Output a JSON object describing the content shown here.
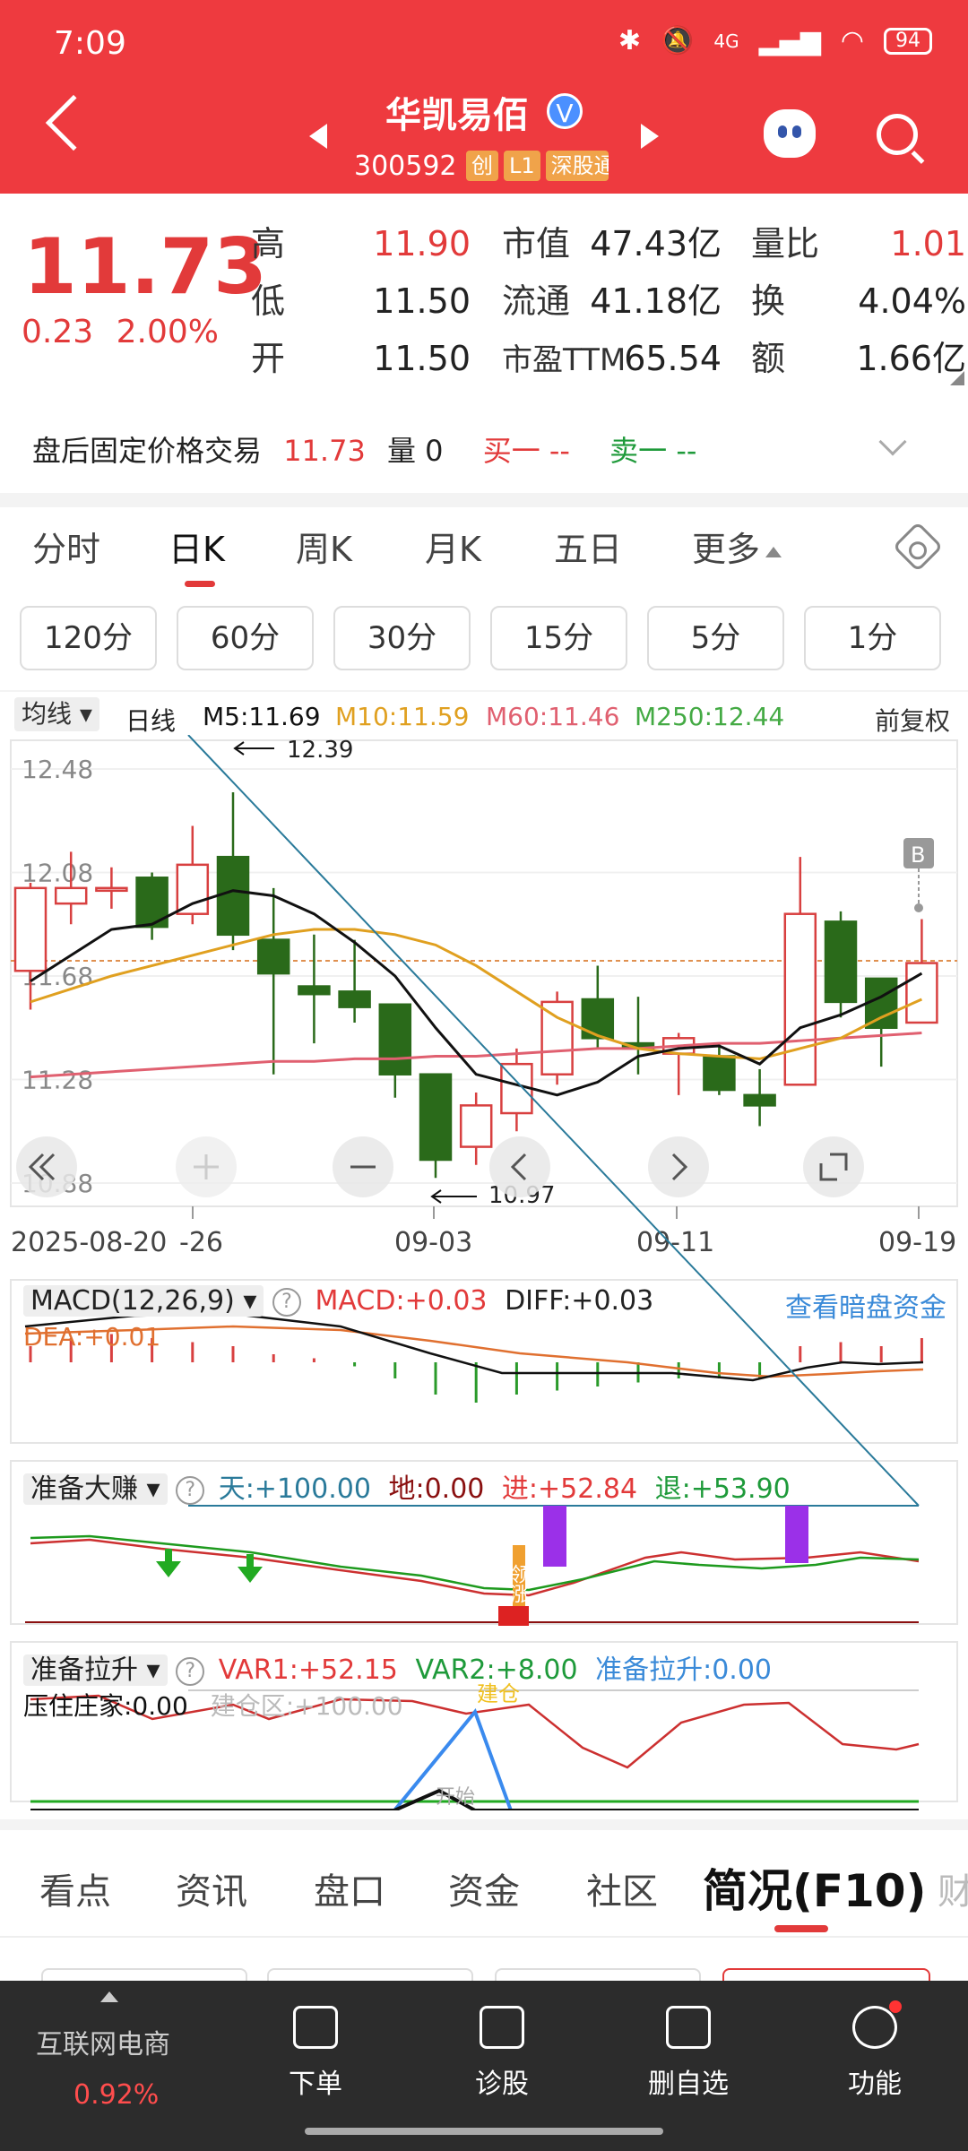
{
  "status": {
    "time": "7:09",
    "network": "4G",
    "battery": "94"
  },
  "header": {
    "stock_name": "华凯易佰",
    "verified_mark": "V",
    "stock_code": "300592",
    "tags": [
      "创",
      "L1",
      "深股通"
    ]
  },
  "quote": {
    "price": "11.73",
    "change": "0.23",
    "change_pct": "2.00%",
    "rows": [
      {
        "l1": "高",
        "v1": "11.90",
        "l2": "市值",
        "v2": "47.43亿",
        "l3": "量比",
        "v3": "1.01"
      },
      {
        "l1": "低",
        "v1": "11.50",
        "l2": "流通",
        "v2": "41.18亿",
        "l3": "换",
        "v3": "4.04%"
      },
      {
        "l1": "开",
        "v1": "11.50",
        "l2": "市盈TTM",
        "v2": "65.54",
        "l3": "额",
        "v3": "1.66亿"
      }
    ]
  },
  "after_hours": {
    "label": "盘后固定价格交易",
    "price": "11.73",
    "vol_label": "量 0",
    "buy": "买一 --",
    "sell": "卖一 --"
  },
  "period_tabs": [
    "分时",
    "日K",
    "周K",
    "月K",
    "五日",
    "更多"
  ],
  "minute_buttons": [
    "120分",
    "60分",
    "30分",
    "15分",
    "5分",
    "1分"
  ],
  "ma_bar": {
    "selector": "均线",
    "daily": "日线",
    "m5": "M5:11.69",
    "m10": "M10:11.59",
    "m60": "M60:11.46",
    "m250": "M250:12.44",
    "adjust": "前复权"
  },
  "colors": {
    "up": "#d84040",
    "down": "#2a6a1a",
    "m5": "#111111",
    "m10": "#e0a020",
    "m60": "#e06070",
    "m250": "#44aa44"
  },
  "chart_data": {
    "type": "candlestick",
    "y_ticks": [
      "12.48",
      "12.08",
      "11.68",
      "11.28",
      "10.88"
    ],
    "x_ticks": [
      "2025-08-20",
      "-26",
      "09-03",
      "09-11",
      "09-19"
    ],
    "high_annotation": "12.39",
    "low_annotation": "10.97",
    "b_marker": "B",
    "candles": [
      {
        "o": 11.7,
        "c": 12.02,
        "h": 12.04,
        "l": 11.55
      },
      {
        "o": 11.96,
        "c": 12.02,
        "h": 12.16,
        "l": 11.88
      },
      {
        "o": 12.02,
        "c": 12.02,
        "h": 12.1,
        "l": 11.94
      },
      {
        "o": 12.06,
        "c": 11.87,
        "h": 12.08,
        "l": 11.82
      },
      {
        "o": 11.92,
        "c": 12.11,
        "h": 12.26,
        "l": 11.88
      },
      {
        "o": 12.14,
        "c": 11.84,
        "h": 12.39,
        "l": 11.78
      },
      {
        "o": 11.82,
        "c": 11.69,
        "h": 12.02,
        "l": 11.3
      },
      {
        "o": 11.64,
        "c": 11.61,
        "h": 11.84,
        "l": 11.42
      },
      {
        "o": 11.62,
        "c": 11.56,
        "h": 11.82,
        "l": 11.5
      },
      {
        "o": 11.57,
        "c": 11.3,
        "h": 11.57,
        "l": 11.21
      },
      {
        "o": 11.3,
        "c": 10.97,
        "h": 11.3,
        "l": 10.9
      },
      {
        "o": 11.02,
        "c": 11.18,
        "h": 11.23,
        "l": 10.95
      },
      {
        "o": 11.15,
        "c": 11.34,
        "h": 11.4,
        "l": 11.08
      },
      {
        "o": 11.3,
        "c": 11.58,
        "h": 11.62,
        "l": 11.26
      },
      {
        "o": 11.59,
        "c": 11.44,
        "h": 11.72,
        "l": 11.4
      },
      {
        "o": 11.42,
        "c": 11.4,
        "h": 11.6,
        "l": 11.3
      },
      {
        "o": 11.38,
        "c": 11.44,
        "h": 11.46,
        "l": 11.22
      },
      {
        "o": 11.37,
        "c": 11.24,
        "h": 11.42,
        "l": 11.22
      },
      {
        "o": 11.22,
        "c": 11.18,
        "h": 11.32,
        "l": 11.1
      },
      {
        "o": 11.26,
        "c": 11.92,
        "h": 12.14,
        "l": 11.26
      },
      {
        "o": 11.89,
        "c": 11.58,
        "h": 11.93,
        "l": 11.52
      },
      {
        "o": 11.67,
        "c": 11.48,
        "h": 11.67,
        "l": 11.33
      },
      {
        "o": 11.5,
        "c": 11.73,
        "h": 11.9,
        "l": 11.5
      }
    ],
    "m5": [
      11.66,
      11.76,
      11.86,
      11.88,
      11.96,
      12.01,
      11.99,
      11.92,
      11.81,
      11.68,
      11.48,
      11.3,
      11.26,
      11.22,
      11.27,
      11.37,
      11.4,
      11.41,
      11.34,
      11.48,
      11.53,
      11.6,
      11.69
    ],
    "m10": [
      11.58,
      11.63,
      11.68,
      11.72,
      11.76,
      11.8,
      11.84,
      11.86,
      11.86,
      11.84,
      11.8,
      11.72,
      11.62,
      11.52,
      11.45,
      11.4,
      11.38,
      11.37,
      11.36,
      11.4,
      11.44,
      11.52,
      11.59
    ],
    "m60": [
      11.29,
      11.3,
      11.31,
      11.32,
      11.33,
      11.34,
      11.35,
      11.35,
      11.36,
      11.36,
      11.37,
      11.37,
      11.38,
      11.39,
      11.4,
      11.4,
      11.41,
      11.42,
      11.42,
      11.43,
      11.44,
      11.45,
      11.46
    ]
  },
  "macd": {
    "name": "MACD(12,26,9)",
    "macd": "MACD:+0.03",
    "diff": "DIFF:+0.03",
    "dea": "DEA:+0.01",
    "link": "查看暗盘资金"
  },
  "zbdz": {
    "name": "准备大赚",
    "tian": "天:+100.00",
    "di": "地:0.00",
    "jin": "进:+52.84",
    "tui": "退:+53.90",
    "tag_text": "领涨"
  },
  "zbls": {
    "name": "准备拉升",
    "var1": "VAR1:+52.15",
    "var2": "VAR2:+8.00",
    "zbls": "准备拉升:0.00",
    "yzzj": "压住庄家:0.00",
    "jcq": "建仓区:+100.00",
    "jc": "建仓",
    "ks": "开始"
  },
  "info_tabs": [
    "看点",
    "资讯",
    "盘口",
    "资金",
    "社区",
    "简况(F10)",
    "财"
  ],
  "bottom_bar": {
    "sector": "互联网电商",
    "sector_pct": "0.92%",
    "items": [
      "下单",
      "诊股",
      "删自选",
      "功能"
    ]
  }
}
